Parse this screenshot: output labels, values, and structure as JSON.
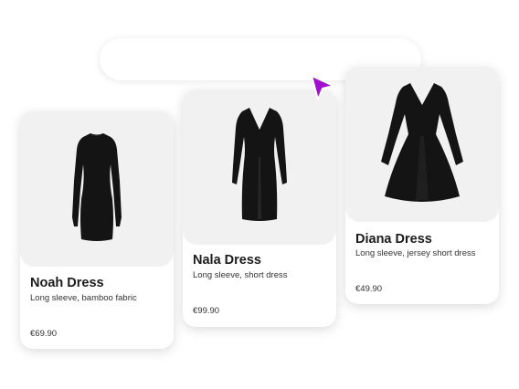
{
  "search": {
    "value": ""
  },
  "products": [
    {
      "name": "Noah Dress",
      "description": "Long sleeve, bamboo fabric",
      "price": "€69.90",
      "image_icon": "bodycon-dress-image"
    },
    {
      "name": "Nala Dress",
      "description": "Long sleeve, short dress",
      "price": "€99.90",
      "image_icon": "v-neck-sheath-dress-image"
    },
    {
      "name": "Diana Dress",
      "description": "Long sleeve, jersey short dress",
      "price": "€49.90",
      "image_icon": "skater-dress-image"
    }
  ],
  "colors": {
    "cursor": "#a10fcf",
    "card_image_bg": "#f1f1f1",
    "dress": "#141414"
  }
}
